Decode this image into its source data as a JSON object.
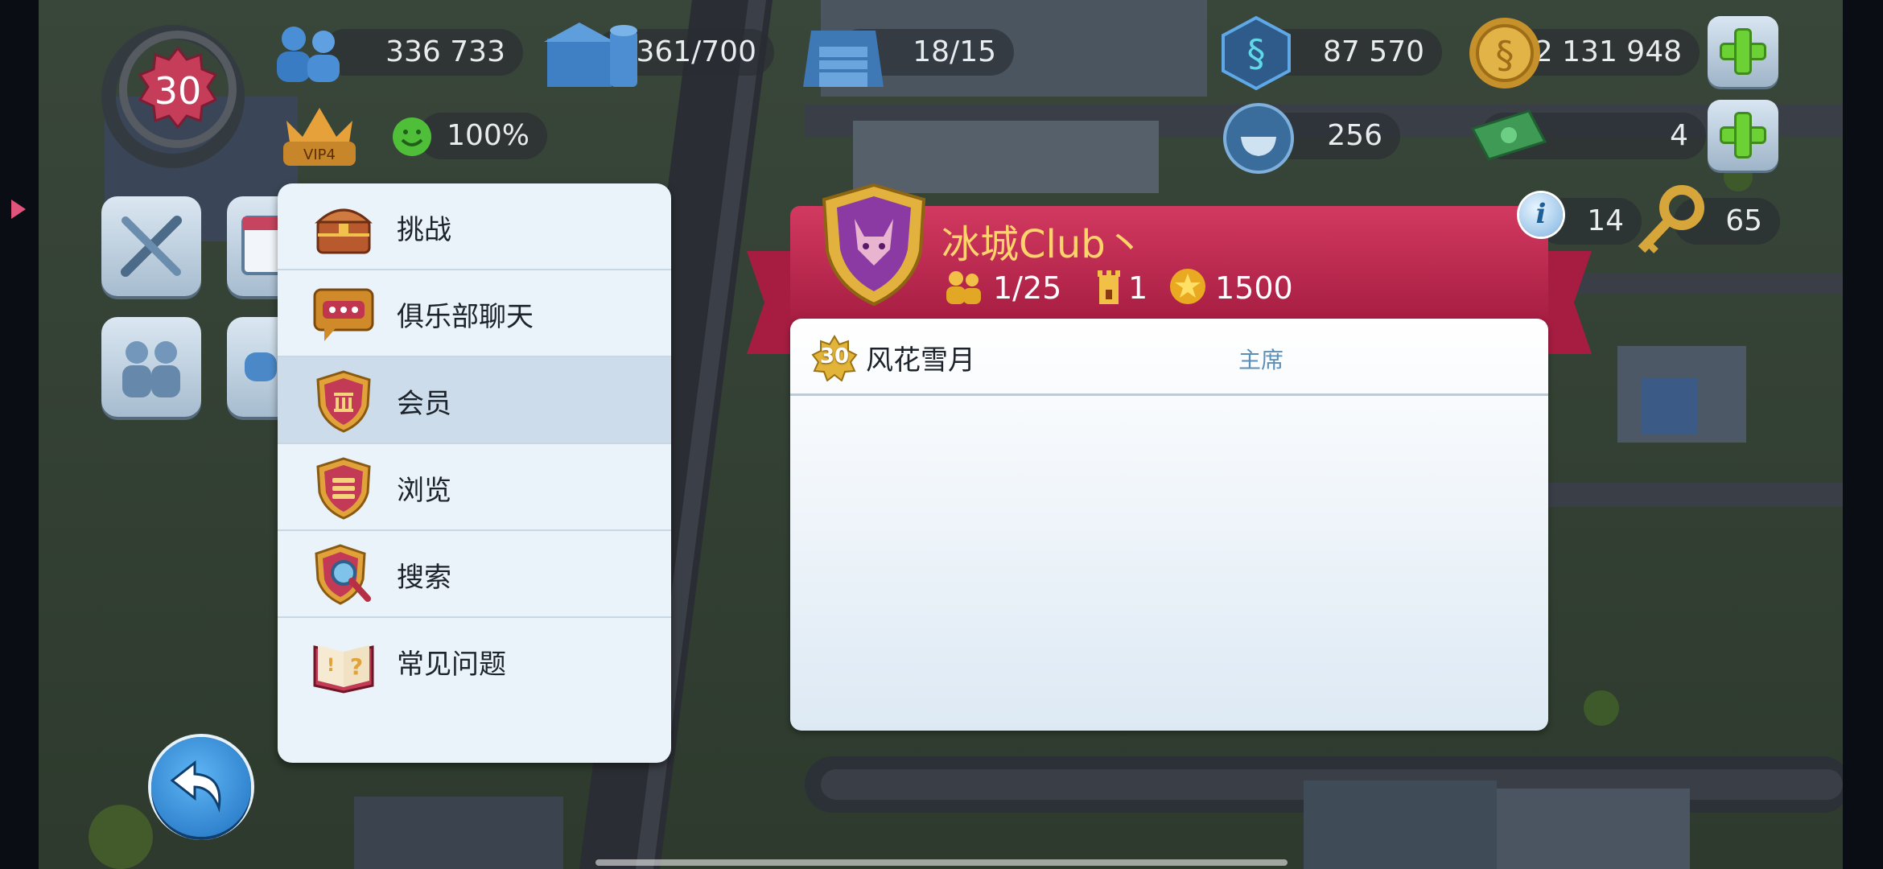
{
  "hud": {
    "level": "30",
    "population": "336 733",
    "storage": "361/700",
    "vu_count": "18/15",
    "simoleons": "87 570",
    "simcash": "2 131 948",
    "vip": "VIP4",
    "happiness": "100%",
    "ore": "256",
    "banknotes": "4",
    "tokens_a": "14",
    "keys": "65"
  },
  "menu": {
    "items": [
      {
        "label": "挑战",
        "icon": "treasure-chest-icon"
      },
      {
        "label": "俱乐部聊天",
        "icon": "chat-bubble-icon"
      },
      {
        "label": "会员",
        "icon": "members-shield-icon",
        "active": true
      },
      {
        "label": "浏览",
        "icon": "browse-shield-icon"
      },
      {
        "label": "搜索",
        "icon": "search-shield-icon"
      },
      {
        "label": "常见问题",
        "icon": "faq-book-icon"
      }
    ]
  },
  "club": {
    "name": "冰城Club丶",
    "members": "1/25",
    "towers": "1",
    "points": "1500",
    "member_list": [
      {
        "level": "30",
        "name": "风花雪月",
        "role": "主席"
      }
    ]
  },
  "colors": {
    "banner": "#c02a52",
    "club_name": "#ffd36b",
    "role_text": "#5b8fb8",
    "plus_green": "#6bd135"
  }
}
